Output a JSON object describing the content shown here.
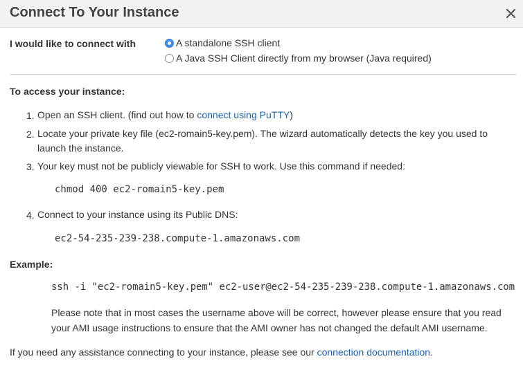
{
  "dialog": {
    "title": "Connect To Your Instance",
    "close_icon": "close-icon"
  },
  "connect_with": {
    "label": "I would like to connect with",
    "options": [
      {
        "label": "A standalone SSH client",
        "selected": true
      },
      {
        "label": "A Java SSH Client directly from my browser (Java required)",
        "selected": false
      }
    ]
  },
  "access": {
    "heading": "To access your instance:",
    "steps": [
      {
        "num": "1.",
        "text_before": "Open an SSH client. (find out how to ",
        "link": "connect using PuTTY",
        "text_after": ")"
      },
      {
        "num": "2.",
        "line1": "Locate your private key file (ec2-romain5-key.pem). The wizard automatically detects the key you used to",
        "line2": "launch the instance."
      },
      {
        "num": "3.",
        "text": "Your key must not be publicly viewable for SSH to work. Use this command if needed:"
      },
      {
        "num": "4.",
        "text": "Connect to your instance using its Public DNS:"
      }
    ],
    "chmod_command": "chmod 400 ec2-romain5-key.pem",
    "public_dns": "ec2-54-235-239-238.compute-1.amazonaws.com"
  },
  "example": {
    "heading": "Example:",
    "ssh_command": "ssh -i \"ec2-romain5-key.pem\" ec2-user@ec2-54-235-239-238.compute-1.amazonaws.com",
    "note_line1": "Please note that in most cases the username above will be correct, however please ensure that you read",
    "note_line2": "your AMI usage instructions to ensure that the AMI owner has not changed the default AMI username."
  },
  "footer": {
    "text": "If you need any assistance connecting to your instance, please see our ",
    "link": "connection documentation",
    "period": "."
  },
  "colors": {
    "link": "#1a5fb4",
    "radio_selected": "#3d8ee6",
    "header_bg": "#f2f2f2"
  }
}
